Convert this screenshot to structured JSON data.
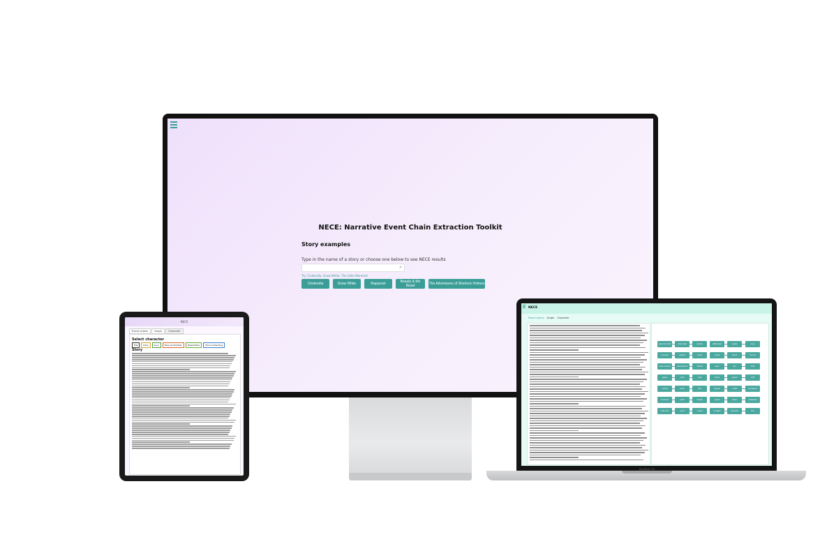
{
  "monitor": {
    "title": "NECE: Narrative Event Chain Extraction Toolkit",
    "subtitle": "Story examples",
    "instruction": "Type in the name of a story or choose one below to see NECE results",
    "search": {
      "value": "",
      "placeholder": ""
    },
    "hint": "Try: Cinderella, Snow White, The Little Mermaid",
    "buttons": [
      "Cinderella",
      "Snow White",
      "Rapunzel",
      "Beauty & the Beast",
      "The Adventures of Sherlock Holmes"
    ]
  },
  "tablet": {
    "top_label": "NECE",
    "tabs": [
      "Event chains",
      "Graph",
      "Character"
    ],
    "active_tab": "Character",
    "select_heading": "Select character",
    "characters": [
      "Ella",
      "Dora",
      "Lucy",
      "Fairy Godmother",
      "Stepmother",
      "Prince Charming"
    ],
    "story_heading": "Story"
  },
  "laptop": {
    "app_title": "NECE",
    "tabs": [
      "Event chains",
      "Graph",
      "Character"
    ],
    "active_tab": "Event chains",
    "brand": "MacBook Pro",
    "nodes": [
      "was hurried",
      "unlocked",
      "wrote",
      "attacked",
      "woke",
      "rose",
      "moved",
      "asked",
      "lived",
      "crept",
      "went",
      "found",
      "was raised",
      "wondered",
      "chose",
      "saw",
      "ran",
      "told",
      "gave",
      "met",
      "lost",
      "tried",
      "spied",
      "left",
      "came",
      "took",
      "fell",
      "spoke",
      "ruled",
      "escaped",
      "hurried",
      "sent",
      "made",
      "grew",
      "kept",
      "pleaded",
      "married",
      "wed",
      "ruled",
      "sought",
      "danced",
      "hid"
    ]
  },
  "colors": {
    "accent": "#3a9e97",
    "monitor_bg": "#efe0fb",
    "laptop_bg": "#e6fbf5",
    "tablet_bg": "#fbf6ff"
  }
}
